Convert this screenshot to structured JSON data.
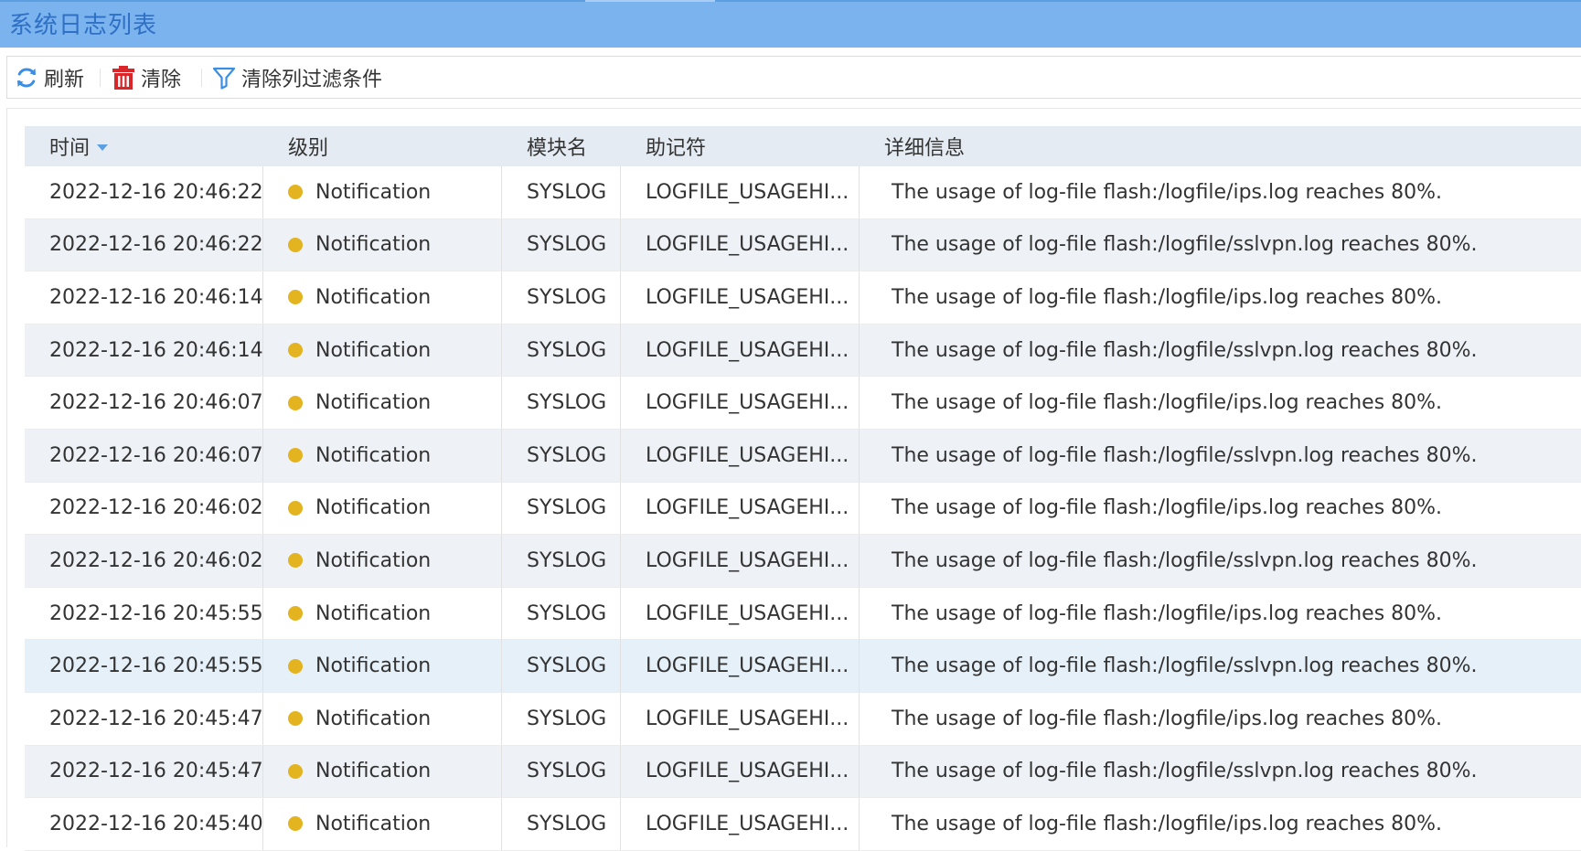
{
  "window": {
    "title": "系统日志列表"
  },
  "toolbar": {
    "refresh_label": "刷新",
    "clear_label": "清除",
    "clear_filters_label": "清除列过滤条件"
  },
  "colors": {
    "titlebar_bg": "#7ab3ee",
    "title_text": "#2f6fc4",
    "header_bg": "#e5ebf2",
    "alt_row_bg": "#eef2f7",
    "notification_dot": "#e3b320",
    "refresh_icon": "#3a8ee6",
    "trash_icon": "#d9262b",
    "filter_icon": "#3a8ee6"
  },
  "table": {
    "columns": {
      "time": "时间",
      "level": "级别",
      "module": "模块名",
      "mnemonic": "助记符",
      "detail": "详细信息"
    },
    "sort_column": "time",
    "rows": [
      {
        "time": "2022-12-16 20:46:22",
        "level": "Notification",
        "module": "SYSLOG",
        "mnemonic": "LOGFILE_USAGEHI...",
        "detail": "The usage of log-file flash:/logfile/ips.log reaches 80%."
      },
      {
        "time": "2022-12-16 20:46:22",
        "level": "Notification",
        "module": "SYSLOG",
        "mnemonic": "LOGFILE_USAGEHI...",
        "detail": "The usage of log-file flash:/logfile/sslvpn.log reaches 80%."
      },
      {
        "time": "2022-12-16 20:46:14",
        "level": "Notification",
        "module": "SYSLOG",
        "mnemonic": "LOGFILE_USAGEHI...",
        "detail": "The usage of log-file flash:/logfile/ips.log reaches 80%."
      },
      {
        "time": "2022-12-16 20:46:14",
        "level": "Notification",
        "module": "SYSLOG",
        "mnemonic": "LOGFILE_USAGEHI...",
        "detail": "The usage of log-file flash:/logfile/sslvpn.log reaches 80%."
      },
      {
        "time": "2022-12-16 20:46:07",
        "level": "Notification",
        "module": "SYSLOG",
        "mnemonic": "LOGFILE_USAGEHI...",
        "detail": "The usage of log-file flash:/logfile/ips.log reaches 80%."
      },
      {
        "time": "2022-12-16 20:46:07",
        "level": "Notification",
        "module": "SYSLOG",
        "mnemonic": "LOGFILE_USAGEHI...",
        "detail": "The usage of log-file flash:/logfile/sslvpn.log reaches 80%."
      },
      {
        "time": "2022-12-16 20:46:02",
        "level": "Notification",
        "module": "SYSLOG",
        "mnemonic": "LOGFILE_USAGEHI...",
        "detail": "The usage of log-file flash:/logfile/ips.log reaches 80%."
      },
      {
        "time": "2022-12-16 20:46:02",
        "level": "Notification",
        "module": "SYSLOG",
        "mnemonic": "LOGFILE_USAGEHI...",
        "detail": "The usage of log-file flash:/logfile/sslvpn.log reaches 80%."
      },
      {
        "time": "2022-12-16 20:45:55",
        "level": "Notification",
        "module": "SYSLOG",
        "mnemonic": "LOGFILE_USAGEHI...",
        "detail": "The usage of log-file flash:/logfile/ips.log reaches 80%."
      },
      {
        "time": "2022-12-16 20:45:55",
        "level": "Notification",
        "module": "SYSLOG",
        "mnemonic": "LOGFILE_USAGEHI...",
        "detail": "The usage of log-file flash:/logfile/sslvpn.log reaches 80%.",
        "selected": true
      },
      {
        "time": "2022-12-16 20:45:47",
        "level": "Notification",
        "module": "SYSLOG",
        "mnemonic": "LOGFILE_USAGEHI...",
        "detail": "The usage of log-file flash:/logfile/ips.log reaches 80%."
      },
      {
        "time": "2022-12-16 20:45:47",
        "level": "Notification",
        "module": "SYSLOG",
        "mnemonic": "LOGFILE_USAGEHI...",
        "detail": "The usage of log-file flash:/logfile/sslvpn.log reaches 80%."
      },
      {
        "time": "2022-12-16 20:45:40",
        "level": "Notification",
        "module": "SYSLOG",
        "mnemonic": "LOGFILE_USAGEHI...",
        "detail": "The usage of log-file flash:/logfile/ips.log reaches 80%."
      }
    ]
  }
}
